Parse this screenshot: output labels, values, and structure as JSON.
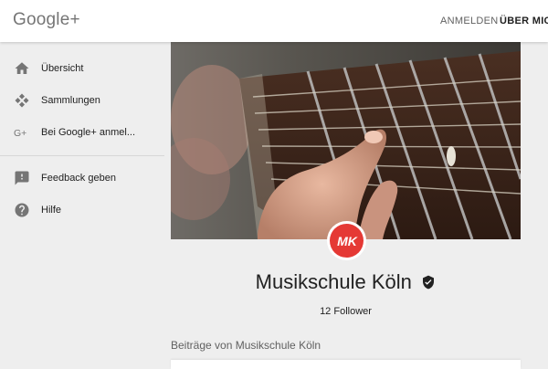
{
  "header": {
    "brand": "Google+",
    "login_label": "ANMELDEN",
    "about_label": "ÜBER MICH"
  },
  "sidebar": {
    "items": [
      {
        "label": "Übersicht",
        "icon": "home-icon"
      },
      {
        "label": "Sammlungen",
        "icon": "collections-icon"
      },
      {
        "label": "Bei Google+ anmel...",
        "icon": "google-plus-icon"
      },
      {
        "label": "Feedback geben",
        "icon": "feedback-icon"
      },
      {
        "label": "Hilfe",
        "icon": "help-icon"
      }
    ]
  },
  "profile": {
    "avatar_initials": "MK",
    "name": "Musikschule Köln",
    "followers": "12 Follower",
    "posts_heading": "Beiträge von Musikschule Köln",
    "cover_image": "guitar-fretboard-photo",
    "verified_icon": "verified-badge-icon"
  },
  "colors": {
    "background": "#eeeeee",
    "topbar": "#ffffff",
    "avatar": "#e53935",
    "text": "#212121",
    "muted": "#757575"
  }
}
